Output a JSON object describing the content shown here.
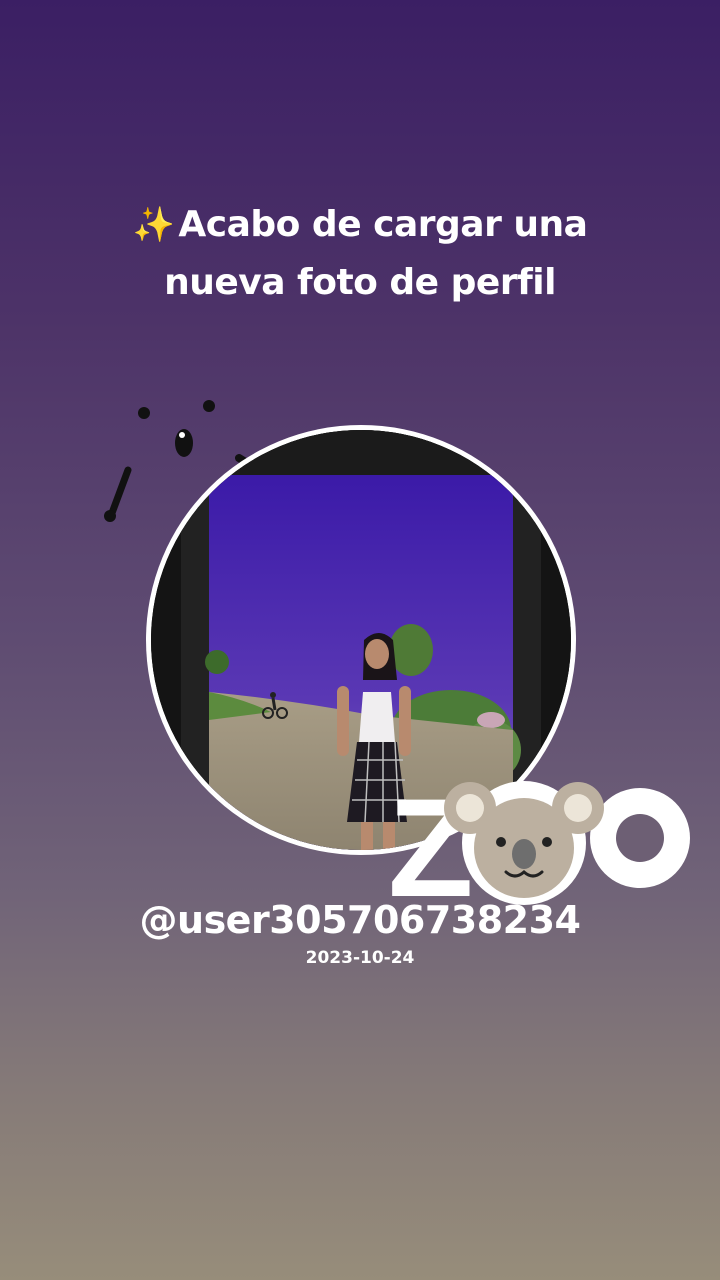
{
  "headline": {
    "sparkle_icon": "sparkles-icon",
    "line1": "Acabo de cargar una",
    "line2": "nueva foto de perfil"
  },
  "profile": {
    "username": "@user305706738234",
    "date": "2023-10-24"
  },
  "sticker": {
    "text": "ZOO",
    "icon": "koala-icon"
  },
  "colors": {
    "background_top": "#3b1f64",
    "background_bottom": "#978d7a",
    "text": "#ffffff",
    "sparkle": "#f5d66b"
  }
}
